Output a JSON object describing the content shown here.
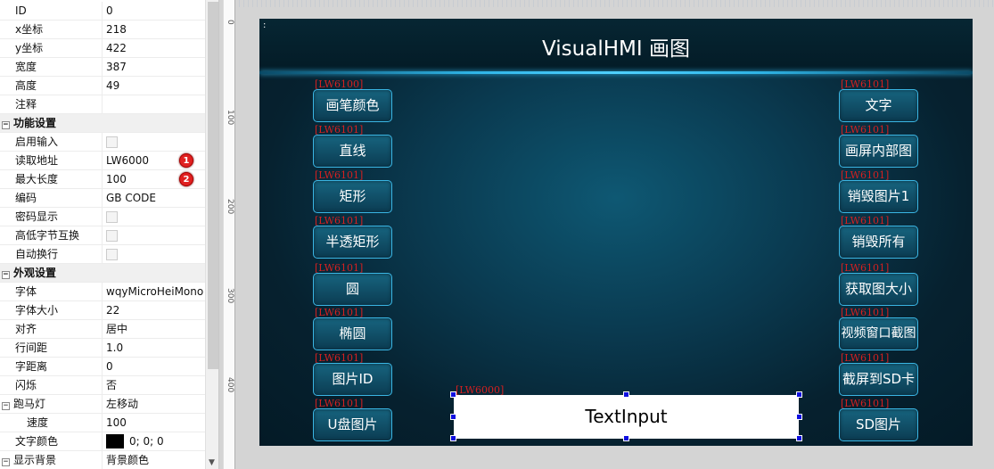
{
  "properties": [
    {
      "name": "ID",
      "value": "0"
    },
    {
      "name": "x坐标",
      "value": "218"
    },
    {
      "name": "y坐标",
      "value": "422"
    },
    {
      "name": "宽度",
      "value": "387"
    },
    {
      "name": "高度",
      "value": "49"
    },
    {
      "name": "注释",
      "value": ""
    }
  ],
  "category_function": "功能设置",
  "function_props": [
    {
      "name": "启用输入",
      "type": "checkbox"
    },
    {
      "name": "读取地址",
      "value": "LW6000",
      "badge": "1"
    },
    {
      "name": "最大长度",
      "value": "100",
      "badge": "2"
    },
    {
      "name": "编码",
      "value": "GB CODE"
    },
    {
      "name": "密码显示",
      "type": "checkbox"
    },
    {
      "name": "高低字节互换",
      "type": "checkbox"
    },
    {
      "name": "自动换行",
      "type": "checkbox"
    }
  ],
  "category_appearance": "外观设置",
  "appearance_props": [
    {
      "name": "字体",
      "value": "wqyMicroHeiMono"
    },
    {
      "name": "字体大小",
      "value": "22"
    },
    {
      "name": "对齐",
      "value": "居中"
    },
    {
      "name": "行间距",
      "value": "1.0"
    },
    {
      "name": "字距离",
      "value": "0"
    },
    {
      "name": "闪烁",
      "value": "否"
    },
    {
      "name": "跑马灯",
      "value": "左移动"
    },
    {
      "name": "速度",
      "value": "100"
    },
    {
      "name": "文字颜色",
      "value": "0; 0; 0"
    },
    {
      "name": "显示背景",
      "value": "背景颜色"
    }
  ],
  "ruler_ticks": [
    "0",
    "100",
    "200",
    "300",
    "400"
  ],
  "screen": {
    "dots": ":",
    "title": "VisualHMI 画图",
    "left_buttons": [
      {
        "label": "画笔颜色",
        "addr": "[LW6100]"
      },
      {
        "label": "直线",
        "addr": "[LW6101]"
      },
      {
        "label": "矩形",
        "addr": "[LW6101]"
      },
      {
        "label": "半透矩形",
        "addr": "[LW6101]"
      },
      {
        "label": "圆",
        "addr": "[LW6101]"
      },
      {
        "label": "椭圆",
        "addr": "[LW6101]"
      },
      {
        "label": "图片ID",
        "addr": "[LW6101]"
      },
      {
        "label": "U盘图片",
        "addr": "[LW6101]"
      }
    ],
    "right_buttons": [
      {
        "label": "文字",
        "addr": "[LW6101]"
      },
      {
        "label": "画屏内部图",
        "addr": "[LW6101]"
      },
      {
        "label": "销毁图片1",
        "addr": "[LW6101]"
      },
      {
        "label": "销毁所有",
        "addr": "[LW6101]"
      },
      {
        "label": "获取图大小",
        "addr": "[LW6101]"
      },
      {
        "label": "视频窗口截图",
        "addr": "[LW6101]"
      },
      {
        "label": "截屏到SD卡",
        "addr": "[LW6101]"
      },
      {
        "label": "SD图片",
        "addr": "[LW6101]"
      }
    ],
    "text_input": {
      "label": "TextInput",
      "addr": "[LW6000]"
    }
  },
  "colors": {
    "text_color": "#000000",
    "accent": "#3ab6e4",
    "addr_label": "#d52020"
  }
}
